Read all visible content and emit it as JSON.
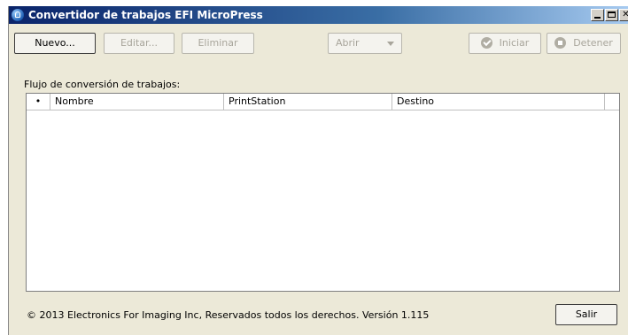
{
  "window": {
    "title": "Convertidor de trabajos EFI MicroPress"
  },
  "toolbar": {
    "new_label": "Nuevo...",
    "edit_label": "Editar...",
    "delete_label": "Eliminar",
    "open_label": "Abrir",
    "start_label": "Iniciar",
    "stop_label": "Detener"
  },
  "flow": {
    "label": "Flujo de conversión de trabajos:",
    "columns": [
      "•",
      "Nombre",
      "PrintStation",
      "Destino"
    ],
    "rows": []
  },
  "footer": {
    "copyright": "© 2013 Electronics For Imaging Inc, Reservados todos los derechos. Versión 1.115",
    "exit_label": "Salir"
  }
}
